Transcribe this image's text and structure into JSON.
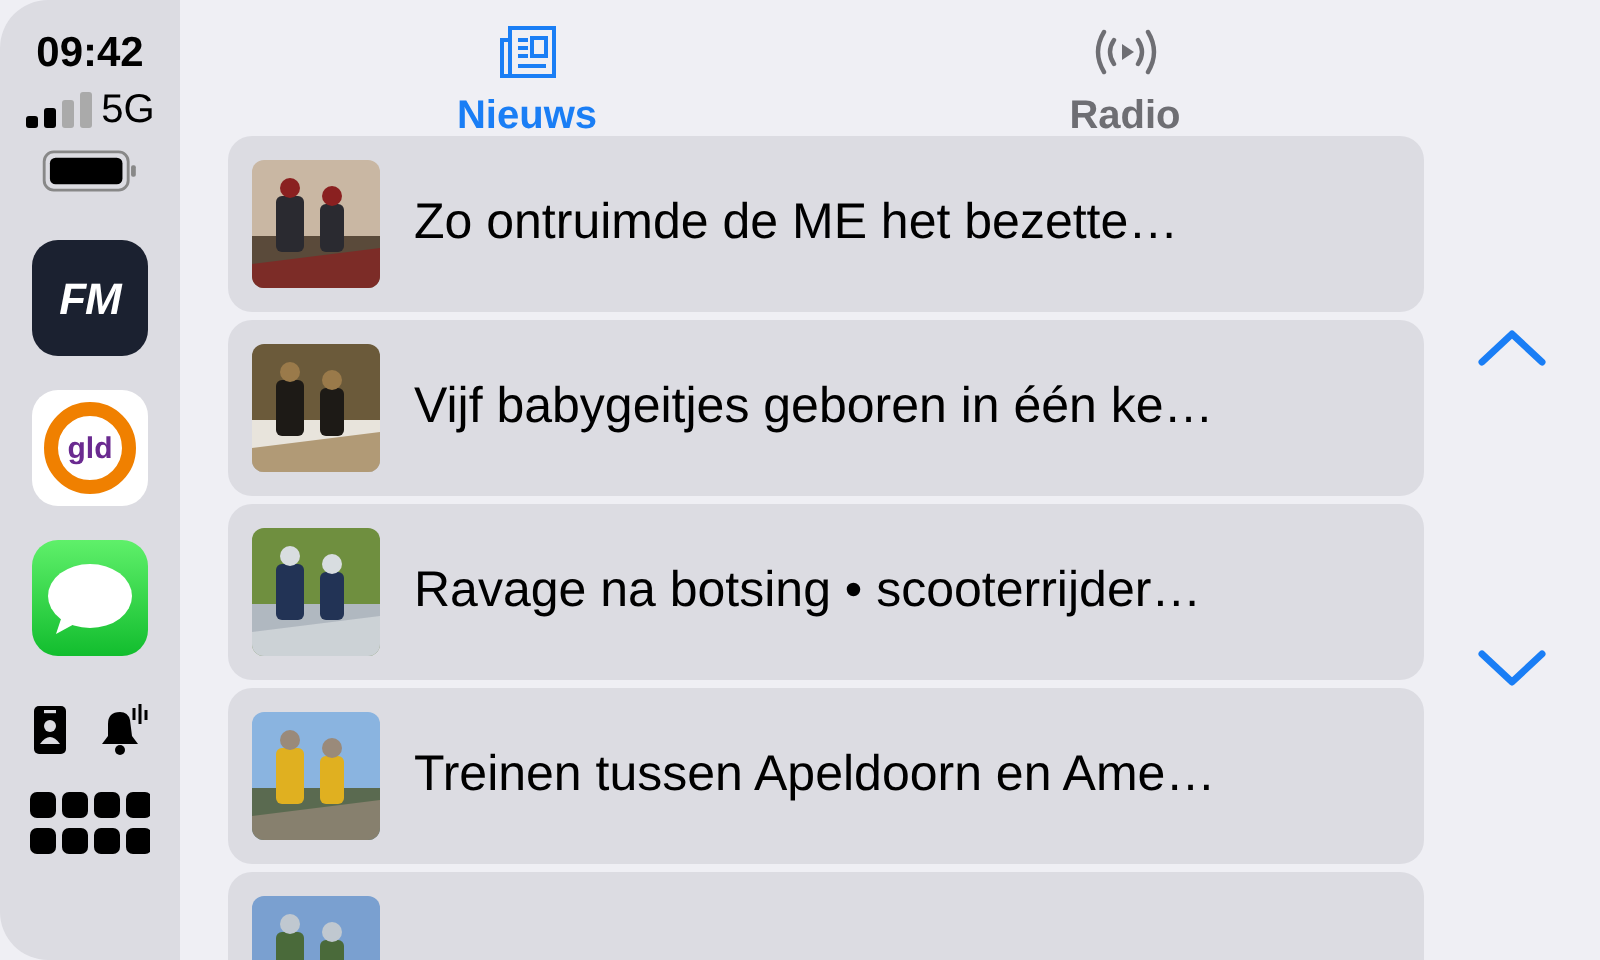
{
  "status_bar": {
    "time": "09:42",
    "network": "5G"
  },
  "dock": {
    "apps": [
      {
        "kind": "fm",
        "label": "FM"
      },
      {
        "kind": "gld",
        "label": "gld"
      },
      {
        "kind": "messages"
      }
    ]
  },
  "tabs": [
    {
      "label": "Nieuws",
      "kind": "news",
      "selected": true
    },
    {
      "label": "Radio",
      "kind": "radio",
      "selected": false
    }
  ],
  "news": [
    {
      "kind": "article",
      "title": "Zo ontruimde de ME het bezette…"
    },
    {
      "kind": "article",
      "title": "Vijf babygeitjes geboren in één ke…"
    },
    {
      "kind": "article",
      "title": "Ravage na botsing • scooterrijder…"
    },
    {
      "kind": "article",
      "title": "Treinen tussen Apeldoorn en Ame…"
    },
    {
      "kind": "picture"
    }
  ]
}
